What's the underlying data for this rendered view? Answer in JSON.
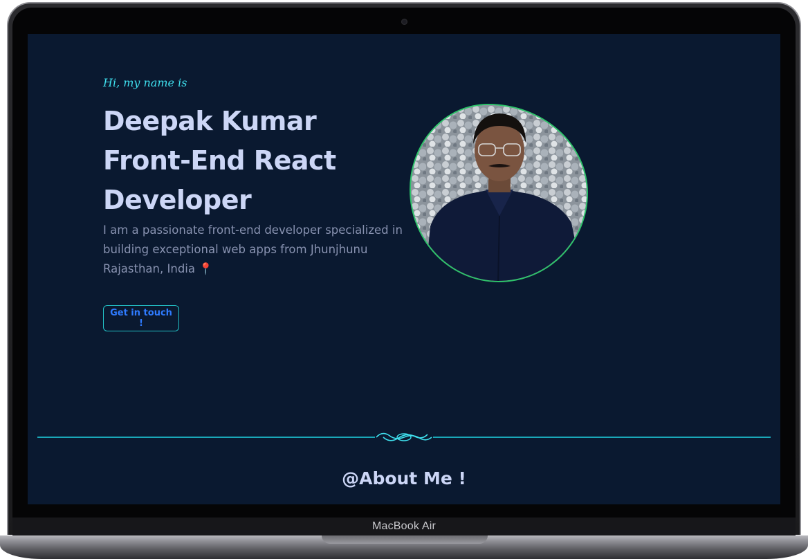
{
  "hero": {
    "greeting": "Hi, my name is",
    "name_line1": "Deepak Kumar",
    "name_line2": "Front-End React",
    "name_line3": "Developer",
    "bio": "I am a passionate front-end developer specialized in building exceptional web apps from Jhunjhunu Rajasthan, India",
    "location_icon": "📍",
    "cta_label": "Get in touch !"
  },
  "about": {
    "heading": "@About Me !"
  },
  "device": {
    "brand_label": "MacBook Air"
  },
  "colors": {
    "background": "#0a1930",
    "accent_cyan": "#3fe0ee",
    "heading_text": "#ccd6f6",
    "body_text": "#8892b0",
    "button_text": "#2f7bff",
    "photo_border": "#2ec36a"
  },
  "icons": {
    "divider_ornament": "swirl-ornament-icon",
    "location": "map-pin-icon"
  }
}
